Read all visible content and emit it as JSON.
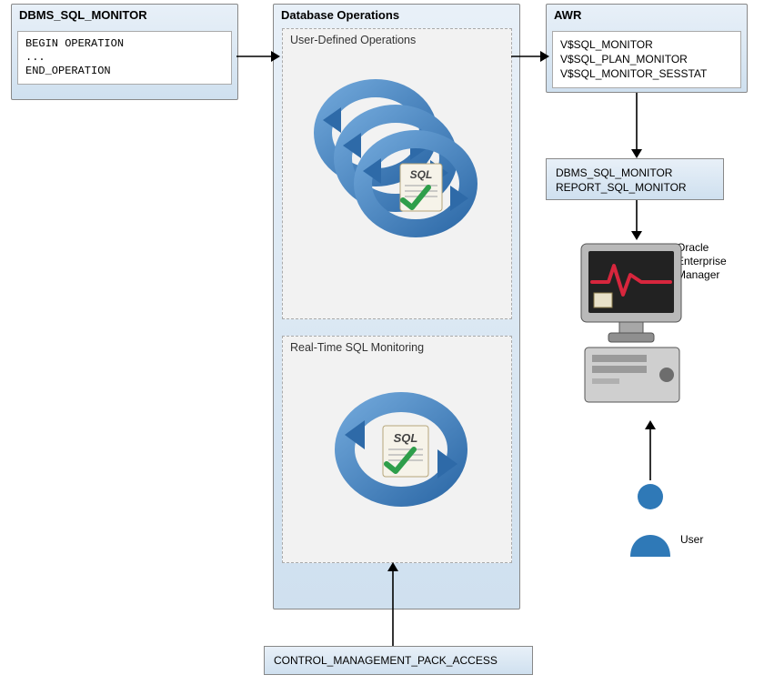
{
  "left": {
    "title": "DBMS_SQL_MONITOR",
    "code": "BEGIN OPERATION\n...\nEND_OPERATION"
  },
  "center": {
    "title": "Database Operations",
    "user_ops_title": "User-Defined Operations",
    "rt_title": "Real-Time SQL Monitoring"
  },
  "right": {
    "awr_title": "AWR",
    "awr_lines": "V$SQL_MONITOR\nV$SQL_PLAN_MONITOR\nV$SQL_MONITOR_SESSTAT",
    "report_lines": "DBMS_SQL_MONITOR\nREPORT_SQL_MONITOR",
    "em_label": "Oracle\nEnterprise\nManager",
    "user_label": "User"
  },
  "bottom": {
    "param": "CONTROL_MANAGEMENT_PACK_ACCESS"
  },
  "icons": {
    "sql_cycle": "sql-cycle-icon",
    "computer": "computer-icon",
    "user": "user-icon"
  }
}
